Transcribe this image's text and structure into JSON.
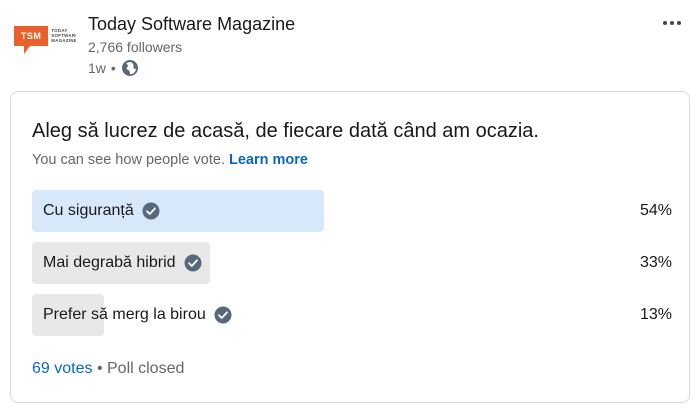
{
  "post": {
    "logo_text": "TSM",
    "logo_subtext": "TODAY SOFTWARE MAGAZINE",
    "author": "Today Software Magazine",
    "followers": "2,766 followers",
    "time": "1w",
    "separator": "•",
    "visibility_icon": "globe-icon",
    "more_icon": "ellipsis-icon"
  },
  "poll": {
    "question": "Aleg să lucrez de acasă, de fiecare dată când am ocazia.",
    "notice": "You can see how people vote.",
    "learn_more": "Learn more",
    "options": [
      {
        "label": "Cu siguranță",
        "percent_label": "54%",
        "fraction": 0.54,
        "selected": true
      },
      {
        "label": "Mai degrabă hibrid",
        "percent_label": "33%",
        "fraction": 0.33,
        "selected": false
      },
      {
        "label": "Prefer să merg la birou",
        "percent_label": "13%",
        "fraction": 0.13,
        "selected": false
      }
    ],
    "votes": "69 votes",
    "separator": "•",
    "status": "Poll closed"
  },
  "colors": {
    "selected_bar": "#d8e8fb",
    "other_bar": "#e8e8e8",
    "link": "#0a66c2",
    "check": "#56687a"
  }
}
